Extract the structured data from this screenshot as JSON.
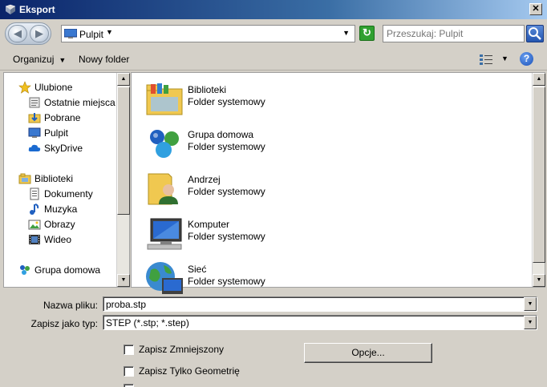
{
  "window": {
    "title": "Eksport",
    "close_label": "✕"
  },
  "address": {
    "location": "Pulpit",
    "search_placeholder": "Przeszukaj: Pulpit"
  },
  "toolbar": {
    "organize": "Organizuj",
    "new_folder": "Nowy folder",
    "help": "?"
  },
  "sidebar": {
    "favorites_header": "Ulubione",
    "favorites": [
      "Ostatnie miejsca",
      "Pobrane",
      "Pulpit",
      "SkyDrive"
    ],
    "libraries_header": "Biblioteki",
    "libraries": [
      "Dokumenty",
      "Muzyka",
      "Obrazy",
      "Wideo"
    ],
    "homegroup": "Grupa domowa"
  },
  "files": [
    {
      "name": "Biblioteki",
      "type": "Folder systemowy",
      "icon": "libraries-icon"
    },
    {
      "name": "Grupa domowa",
      "type": "Folder systemowy",
      "icon": "homegroup-icon"
    },
    {
      "name": "Andrzej",
      "type": "Folder systemowy",
      "icon": "user-folder-icon"
    },
    {
      "name": "Komputer",
      "type": "Folder systemowy",
      "icon": "computer-icon"
    },
    {
      "name": "Sieć",
      "type": "Folder systemowy",
      "icon": "network-icon"
    }
  ],
  "form": {
    "filename_label": "Nazwa pliku:",
    "filename_value": "proba.stp",
    "type_label": "Zapisz jako typ:",
    "type_value": "STEP (*.stp; *.step)",
    "options_button": "Opcje...",
    "checkbox1": "Zapisz Zmniejszony",
    "checkbox2": "Zapisz Tylko Geometrię"
  },
  "colors": {
    "titlebar_start": "#0a246a",
    "dialog_bg": "#d4d0c8",
    "folder_yellow": "#f0c850"
  }
}
